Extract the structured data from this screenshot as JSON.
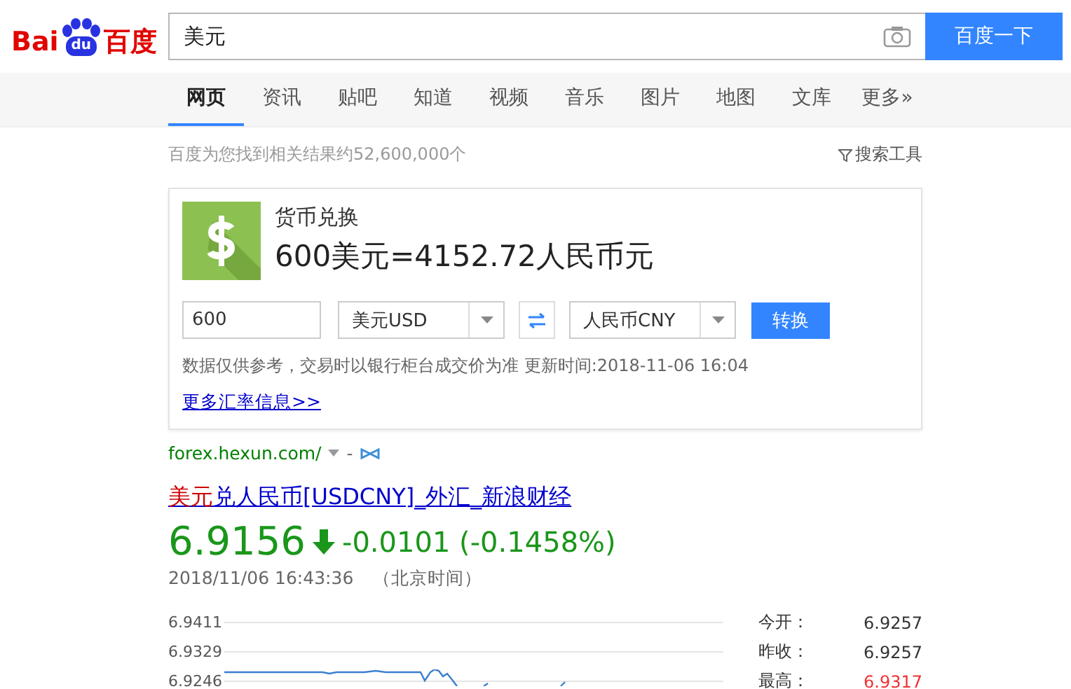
{
  "header": {
    "logo": {
      "left": "Bai",
      "paw": "du",
      "right": "百度"
    },
    "search": {
      "value": "美元"
    },
    "search_button": "百度一下"
  },
  "tabs": [
    {
      "label": "网页",
      "selected": true
    },
    {
      "label": "资讯",
      "selected": false
    },
    {
      "label": "贴吧",
      "selected": false
    },
    {
      "label": "知道",
      "selected": false
    },
    {
      "label": "视频",
      "selected": false
    },
    {
      "label": "音乐",
      "selected": false
    },
    {
      "label": "图片",
      "selected": false
    },
    {
      "label": "地图",
      "selected": false
    },
    {
      "label": "文库",
      "selected": false
    },
    {
      "label": "更多»",
      "selected": false
    }
  ],
  "result_count": "百度为您找到相关结果约52,600,000个",
  "search_tools": "搜索工具",
  "converter": {
    "title": "货币兑换",
    "result": "600美元=4152.72人民币元",
    "amount": "600",
    "from": "美元USD",
    "to": "人民币CNY",
    "convert_button": "转换",
    "note": "数据仅供参考，交易时以银行柜台成交价为准 更新时间:2018-11-06 16:04",
    "more_link": "更多汇率信息>>"
  },
  "source_url": "forex.hexun.com/",
  "source_sep": "-",
  "result": {
    "title_highlight": "美元",
    "title_rest": "兑人民币[USDCNY]_外汇_新浪财经",
    "price": "6.9156",
    "change": "-0.0101 (-0.1458%)",
    "falling": true,
    "time": "2018/11/06 16:43:36",
    "timezone": "（北京时间）",
    "y_labels": [
      "6.9411",
      "6.9329",
      "6.9246"
    ],
    "stats": [
      {
        "label": "今开：",
        "value": "6.9257",
        "kind": "neutral"
      },
      {
        "label": "昨收：",
        "value": "6.9257",
        "kind": "neutral"
      },
      {
        "label": "最高：",
        "value": "6.9317",
        "kind": "up"
      }
    ]
  }
}
